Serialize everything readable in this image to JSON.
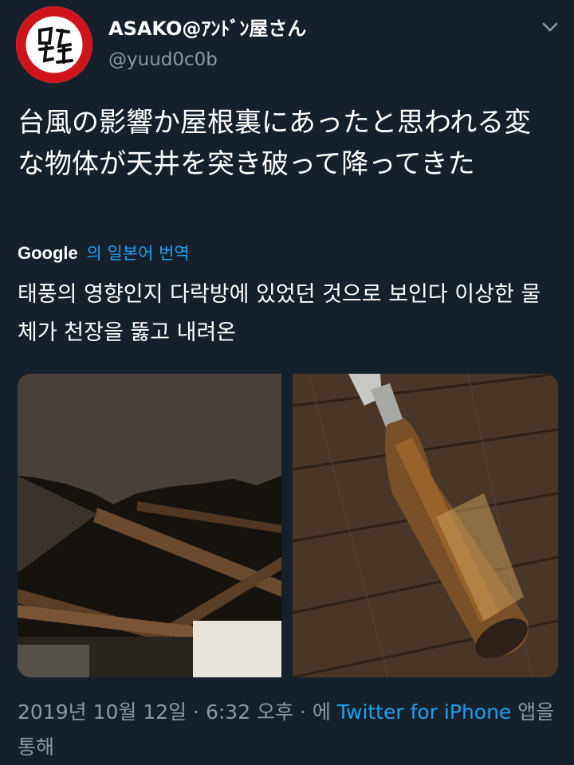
{
  "user": {
    "name": "ASAKO@ｱﾝﾄﾞﾝ屋さん",
    "handle": "@yuud0c0b",
    "avatar_text": "日の丸工芸"
  },
  "tweet": {
    "text": "台風の影響か屋根裏にあったと思われる変な物体が天井を突き破って降ってきた"
  },
  "translation": {
    "provider": "Google",
    "label": "의 일본어 번역",
    "text": "태풍의 영향인지 다락방에 있었던 것으로 보인다 이상한 물체가 천장을 뚫고 내려온"
  },
  "meta": {
    "timestamp": "2019년 10월 12일 · 6:32 오후 · 에 ",
    "source": "Twitter for iPhone",
    "suffix": " 앱을 통해"
  },
  "icons": {
    "menu": "chevron-down-icon"
  },
  "colors": {
    "background": "#15202b",
    "accent": "#1da1f2",
    "secondary_text": "#8899a6",
    "avatar_red": "#d0141b"
  }
}
